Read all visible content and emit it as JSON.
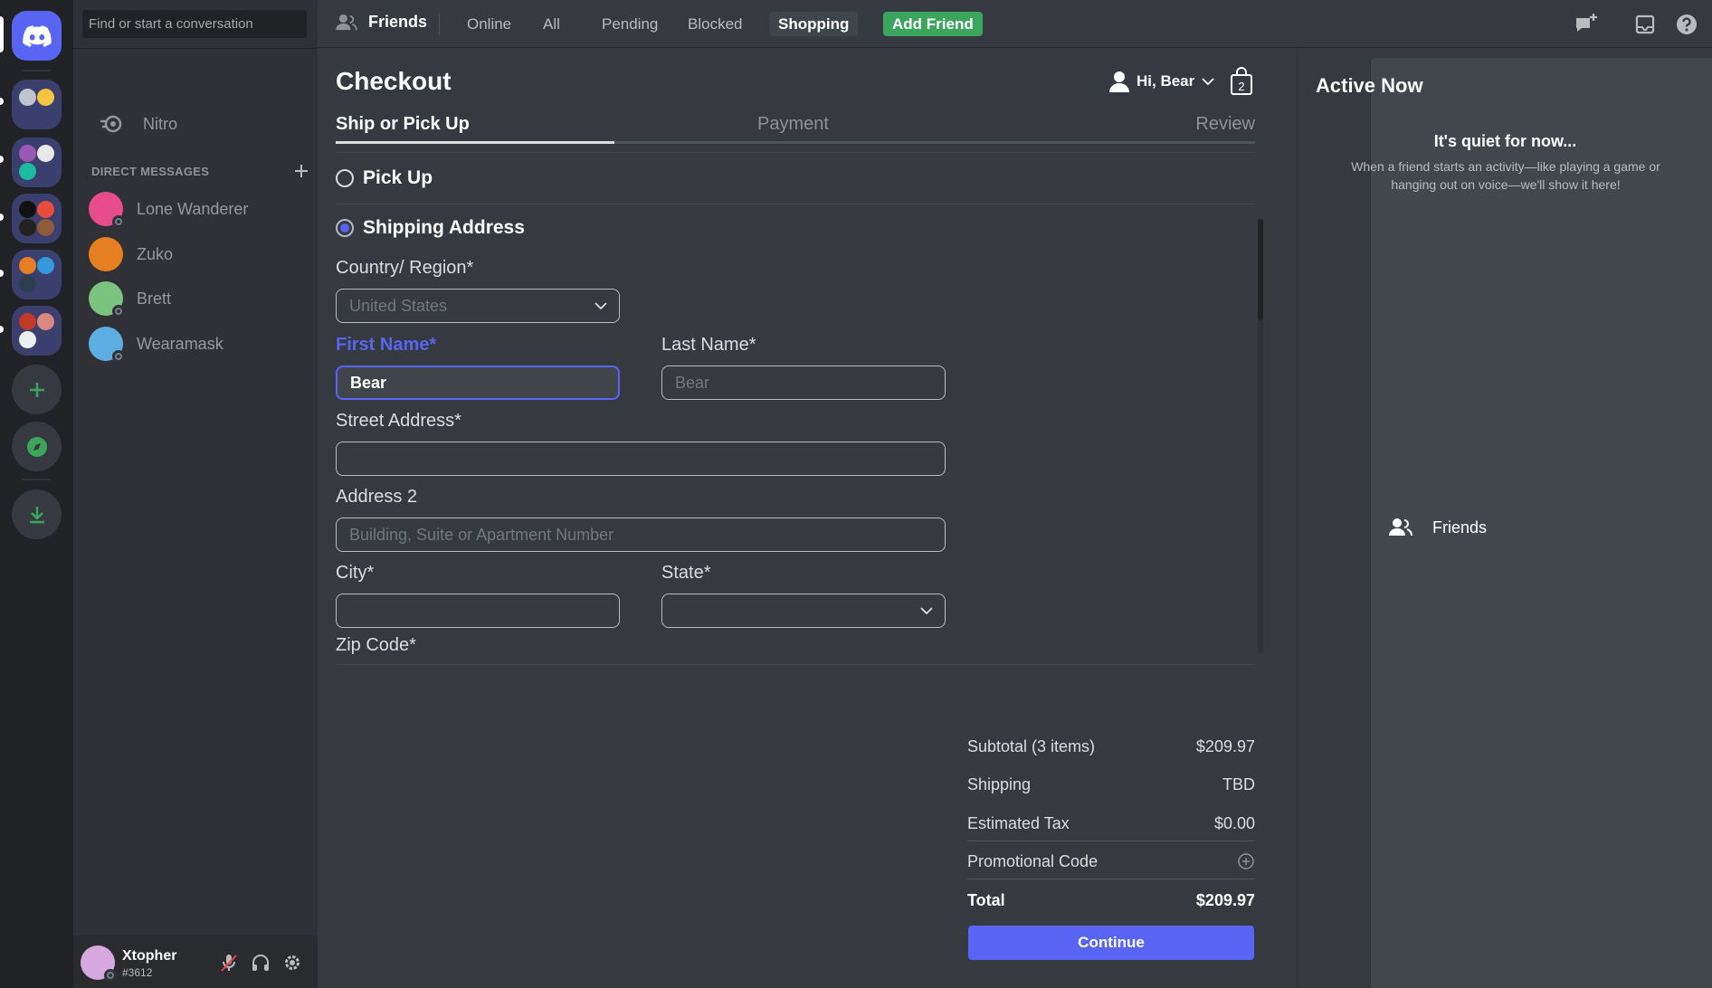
{
  "sidebar": {
    "search_placeholder": "Find or start a conversation",
    "nav": [
      {
        "label": "Friends",
        "icon": "friends-icon"
      },
      {
        "label": "Nitro",
        "icon": "nitro-icon"
      }
    ],
    "dm_header": "DIRECT MESSAGES",
    "dms": [
      {
        "name": "Lone Wanderer"
      },
      {
        "name": "Zuko"
      },
      {
        "name": "Brett"
      },
      {
        "name": "Wearamask"
      }
    ],
    "user": {
      "name": "Xtopher",
      "tag": "#3612"
    }
  },
  "topbar": {
    "title": "Friends",
    "tabs": [
      "Online",
      "All",
      "Pending",
      "Blocked",
      "Shopping"
    ],
    "selected_tab": "Shopping",
    "add_friend": "Add Friend"
  },
  "checkout": {
    "title": "Checkout",
    "greeting": "Hi, Bear",
    "cart_count": "2",
    "steps": [
      "Ship or Pick Up",
      "Payment",
      "Review"
    ],
    "options": {
      "pickup": "Pick Up",
      "shipping": "Shipping Address"
    },
    "fields": {
      "country_label": "Country/ Region*",
      "country_value": "United States",
      "first_name_label": "First Name*",
      "first_name_value": "Bear",
      "last_name_label": "Last Name*",
      "last_name_placeholder": "Bear",
      "street_label": "Street Address*",
      "address2_label": "Address 2",
      "address2_placeholder": "Building, Suite or Apartment Number",
      "city_label": "City*",
      "state_label": "State*",
      "zip_label": "Zip Code*"
    },
    "summary": {
      "subtotal_label": "Subtotal (3 items)",
      "subtotal_value": "$209.97",
      "shipping_label": "Shipping",
      "shipping_value": "TBD",
      "tax_label": "Estimated Tax",
      "tax_value": "$0.00",
      "promo_label": "Promotional Code",
      "total_label": "Total",
      "total_value": "$209.97"
    },
    "continue": "Continue"
  },
  "active_now": {
    "title": "Active Now",
    "quiet": "It's quiet for now...",
    "description": "When a friend starts an activity—like playing a game or hanging out on voice—we'll show it here!"
  },
  "colors": {
    "accent": "#5865f2",
    "green": "#3ba55d",
    "bg": "#36393f",
    "sidebar": "#2f3136",
    "rail": "#202225"
  }
}
